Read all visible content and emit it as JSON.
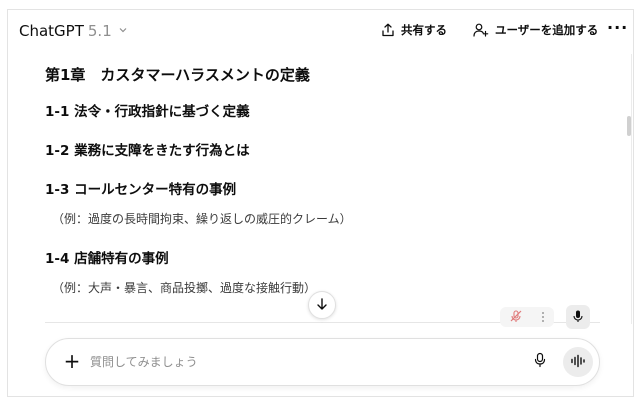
{
  "header": {
    "model_name": "ChatGPT",
    "model_version": "5.1",
    "share_label": "共有する",
    "add_user_label": "ユーザーを追加する",
    "more_label": "···"
  },
  "content": {
    "chapter_title": "第1章　カスタマーハラスメントの定義",
    "sections": [
      {
        "heading": "1-1 法令・行政指針に基づく定義"
      },
      {
        "heading": "1-2 業務に支障をきたす行為とは"
      },
      {
        "heading": "1-3 コールセンター特有の事例",
        "example": "（例：過度の長時間拘束、繰り返しの威圧的クレーム）"
      },
      {
        "heading": "1-4 店舗特有の事例",
        "example": "（例：大声・暴言、商品投擲、過度な接触行動）"
      }
    ]
  },
  "composer": {
    "plus_label": "+",
    "placeholder": "質問してみましょう"
  },
  "icons": {
    "chevron": "chevron-down-icon",
    "share": "share-icon",
    "add_user": "add-user-icon",
    "more": "more-icon",
    "scroll_down": "arrow-down-icon",
    "mute": "mic-off-icon",
    "dots": "vertical-dots-icon",
    "mic": "microphone-icon",
    "voice": "voice-waveform-icon"
  }
}
